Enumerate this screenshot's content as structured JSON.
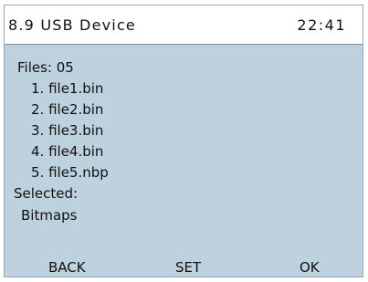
{
  "header": {
    "title": "8.9 USB Device",
    "time": "22:41"
  },
  "files": {
    "count_label": "Files: 05",
    "items": [
      "1. file1.bin",
      "2. file2.bin",
      "3. file3.bin",
      "4. file4.bin",
      "5. file5.nbp"
    ]
  },
  "selection": {
    "label": "Selected:",
    "value": "Bitmaps"
  },
  "softkeys": {
    "back": "BACK",
    "set": "SET",
    "ok": "OK"
  },
  "colors": {
    "screen_background": "#bed1df",
    "header_background": "#ffffff",
    "text": "#111111"
  }
}
